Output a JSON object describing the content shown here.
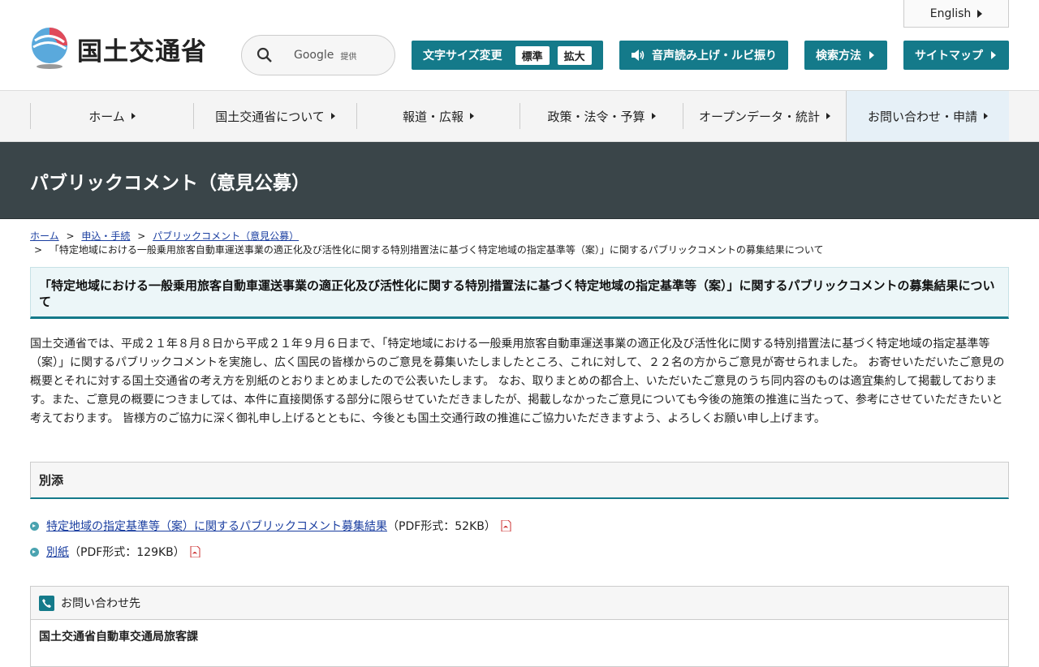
{
  "header": {
    "logo_text": "国土交通省",
    "search": {
      "google_label": "Google",
      "provided_label": "提供"
    },
    "english_label": "English",
    "font_size": {
      "label": "文字サイズ変更",
      "standard": "標準",
      "large": "拡大"
    },
    "voice_label": "音声読み上げ・ルビ振り",
    "search_method_label": "検索方法",
    "sitemap_label": "サイトマップ"
  },
  "nav": {
    "items": [
      {
        "label": "ホーム"
      },
      {
        "label": "国土交通省について"
      },
      {
        "label": "報道・広報"
      },
      {
        "label": "政策・法令・予算"
      },
      {
        "label": "オープンデータ・統計"
      },
      {
        "label": "お問い合わせ・申請"
      }
    ]
  },
  "banner": {
    "title": "パブリックコメント（意見公募）"
  },
  "breadcrumb": {
    "items": [
      "ホーム",
      "申込・手続",
      "パブリックコメント（意見公募）"
    ],
    "separator": ">",
    "current": "「特定地域における一般乗用旅客自動車運送事業の適正化及び活性化に関する特別措置法に基づく特定地域の指定基準等（案）」に関するパブリックコメントの募集結果について"
  },
  "page_title": "「特定地域における一般乗用旅客自動車運送事業の適正化及び活性化に関する特別措置法に基づく特定地域の指定基準等（案）」に関するパブリックコメントの募集結果について",
  "body_text": "国土交通省では、平成２１年８月８日から平成２１年９月６日まで、「特定地域における一般乗用旅客自動車運送事業の適正化及び活性化に関する特別措置法に基づく特定地域の指定基準等（案）」に関するパブリックコメントを実施し、広く国民の皆様からのご意見を募集いたしましたところ、これに対して、２２名の方からご意見が寄せられました。 お寄せいただいたご意見の概要とそれに対する国土交通省の考え方を別紙のとおりまとめましたので公表いたします。 なお、取りまとめの都合上、いただいたご意見のうち同内容のものは適宜集約して掲載しております。また、ご意見の概要につきましては、本件に直接関係する部分に限らせていただきましたが、掲載しなかったご意見についても今後の施策の推進に当たって、参考にさせていただきたいと考えております。 皆様方のご協力に深く御礼申し上げるとともに、今後とも国土交通行政の推進にご協力いただきますよう、よろしくお願い申し上げます。",
  "attachments": {
    "heading": "別添",
    "items": [
      {
        "link": "特定地域の指定基準等（案）に関するパブリックコメント募集結果",
        "meta": "（PDF形式：52KB）"
      },
      {
        "link": "別紙",
        "meta": "（PDF形式：129KB）"
      }
    ]
  },
  "contact": {
    "heading": "お問い合わせ先",
    "department": "国土交通省自動車交通局旅客課"
  },
  "colors": {
    "accent": "#147a8a",
    "banner": "#3a4549",
    "link": "#1a3ea0"
  }
}
